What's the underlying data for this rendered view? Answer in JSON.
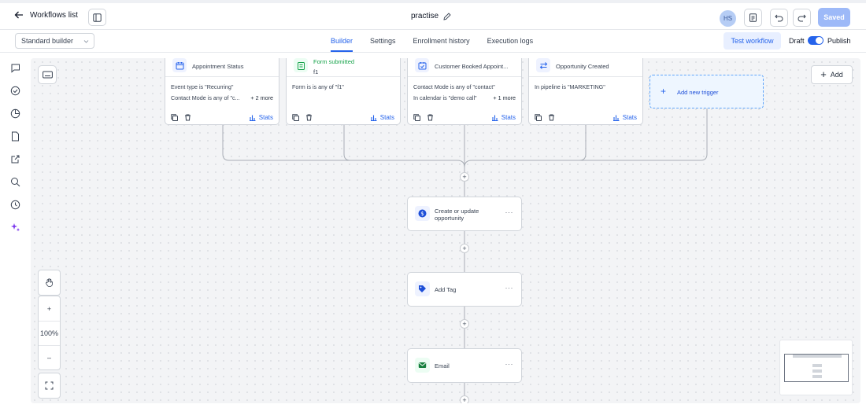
{
  "header": {
    "back_label": "Workflows list",
    "title": "practise",
    "avatar_initials": "HS",
    "saved_label": "Saved"
  },
  "subbar": {
    "builder_select": "Standard builder",
    "tabs": [
      {
        "label": "Builder",
        "active": true
      },
      {
        "label": "Settings",
        "active": false
      },
      {
        "label": "Enrollment history",
        "active": false
      },
      {
        "label": "Execution logs",
        "active": false
      }
    ],
    "test_label": "Test workflow",
    "draft_label": "Draft",
    "publish_label": "Publish",
    "published": true
  },
  "rail_icons": [
    "chat-icon",
    "check-circle-icon",
    "pie-chart-icon",
    "document-icon",
    "external-link-icon",
    "search-icon",
    "history-icon",
    "ai-sparkle-icon"
  ],
  "canvas": {
    "add_label": "Add",
    "new_trigger_label": "Add new trigger",
    "triggers": [
      {
        "title": "Appointment Status",
        "subtitle": "",
        "lines": [
          {
            "text": "Event type is \"Recurring\"",
            "more": ""
          },
          {
            "text": "Contact Mode is any of \"c...",
            "more": "+ 2 more"
          }
        ],
        "stats": "Stats",
        "icon": "calendar-icon"
      },
      {
        "title": "Form submitted",
        "subtitle": "f1",
        "lines": [
          {
            "text": "Form is is any of \"f1\"",
            "more": ""
          }
        ],
        "stats": "Stats",
        "icon": "clipboard-icon"
      },
      {
        "title": "Customer Booked Appoint...",
        "subtitle": "",
        "lines": [
          {
            "text": "Contact Mode is any of \"contact\"",
            "more": ""
          },
          {
            "text": "In calendar is \"demo call\"",
            "more": "+ 1 more"
          }
        ],
        "stats": "Stats",
        "icon": "calendar-check-icon"
      },
      {
        "title": "Opportunity Created",
        "subtitle": "",
        "lines": [
          {
            "text": "In pipeline is \"MARKETING\"",
            "more": ""
          }
        ],
        "stats": "Stats",
        "icon": "swap-arrows-icon"
      }
    ],
    "actions": [
      {
        "label": "Create or update opportunity",
        "icon": "dollar-icon"
      },
      {
        "label": "Add Tag",
        "icon": "tag-icon"
      },
      {
        "label": "Email",
        "icon": "mail-icon"
      }
    ],
    "zoom_level": "100%"
  },
  "colors": {
    "accent": "#2563eb",
    "saved_button": "#9db9f8",
    "canvas_bg": "#f3f4f6",
    "trigger_green": "#16a34a"
  }
}
